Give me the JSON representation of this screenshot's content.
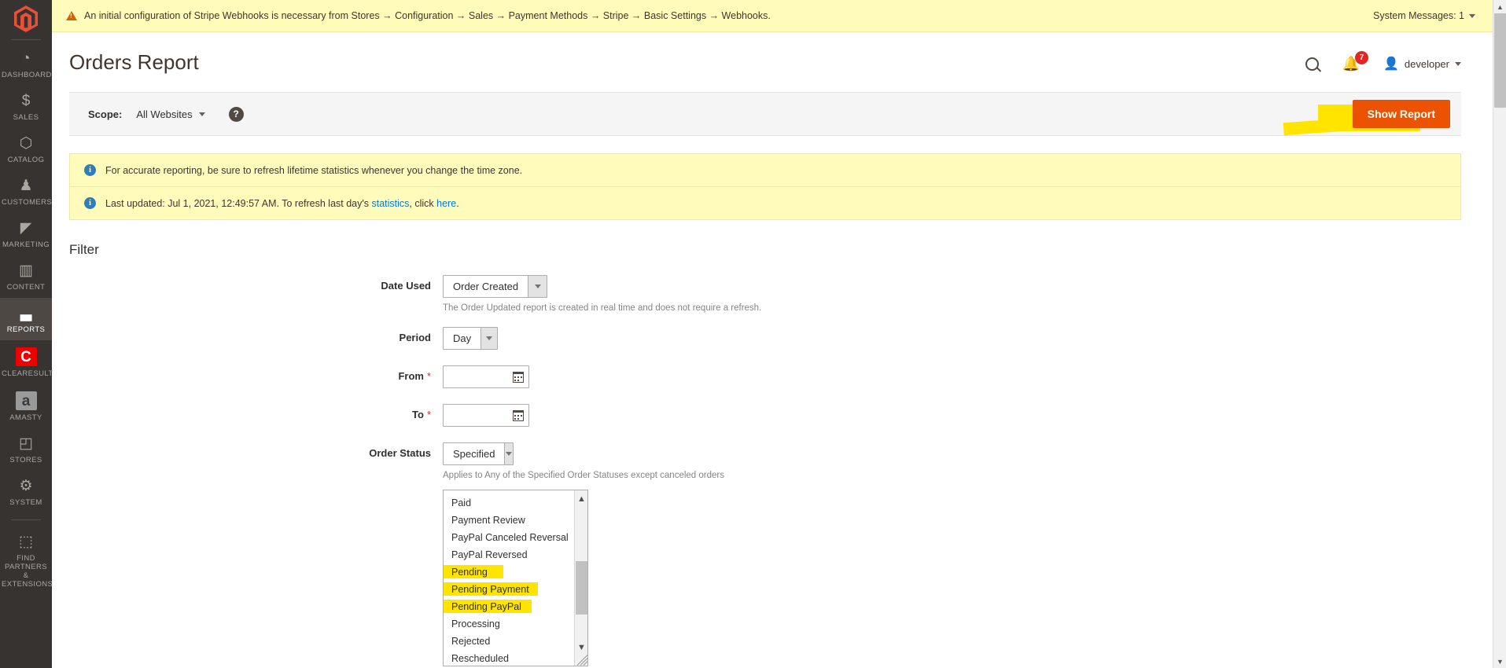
{
  "sysbar": {
    "warning": "An initial configuration of Stripe Webhooks is necessary from Stores → Configuration → Sales → Payment Methods → Stripe → Basic Settings → Webhooks.",
    "system_messages": "System Messages: 1"
  },
  "sidebar": {
    "items": [
      {
        "label": "Dashboard",
        "icon": "dashboard-gauge-icon"
      },
      {
        "label": "Sales",
        "icon": "dollar-icon"
      },
      {
        "label": "Catalog",
        "icon": "box-icon"
      },
      {
        "label": "Customers",
        "icon": "person-icon"
      },
      {
        "label": "Marketing",
        "icon": "megaphone-icon"
      },
      {
        "label": "Content",
        "icon": "layout-icon"
      },
      {
        "label": "Reports",
        "icon": "bar-chart-icon"
      },
      {
        "label": "Clearesult",
        "icon": "clearesult-logo-icon"
      },
      {
        "label": "Amasty",
        "icon": "amasty-logo-icon"
      },
      {
        "label": "Stores",
        "icon": "storefront-icon"
      },
      {
        "label": "System",
        "icon": "gear-icon"
      },
      {
        "label": "Find Partners\n& Extensions",
        "icon": "plugin-box-icon"
      }
    ]
  },
  "header": {
    "title": "Orders Report",
    "search_icon": "search-icon",
    "notifications_icon": "bell-icon",
    "notifications_count": "7",
    "user_name": "developer"
  },
  "scope": {
    "label": "Scope:",
    "value": "All Websites",
    "help_icon": "question-mark-icon",
    "show_report_label": "Show Report"
  },
  "messages": [
    {
      "icon": "info-icon",
      "text": "For accurate reporting, be sure to refresh lifetime statistics whenever you change the time zone."
    },
    {
      "icon": "info-icon",
      "prefix": "Last updated: Jul 1, 2021, 12:49:57 AM. To refresh last day's ",
      "link1": "statistics",
      "middle": ", click ",
      "link2": "here",
      "suffix": "."
    }
  ],
  "filter": {
    "title": "Filter",
    "date_used": {
      "label": "Date Used",
      "value": "Order Created",
      "hint": "The Order Updated report is created in real time and does not require a refresh."
    },
    "period": {
      "label": "Period",
      "value": "Day"
    },
    "from": {
      "label": "From",
      "value": "",
      "placeholder": "",
      "required": "*",
      "icon": "calendar-icon"
    },
    "to": {
      "label": "To",
      "value": "",
      "placeholder": "",
      "required": "*",
      "icon": "calendar-icon"
    },
    "order_status": {
      "label": "Order Status",
      "value": "Specified",
      "hint": "Applies to Any of the Specified Order Statuses except canceled orders"
    },
    "status_options": [
      {
        "label": "",
        "clipped": true,
        "highlighted": false
      },
      {
        "label": "Paid",
        "highlighted": false
      },
      {
        "label": "Payment Review",
        "highlighted": false
      },
      {
        "label": "PayPal Canceled Reversal",
        "highlighted": false
      },
      {
        "label": "PayPal Reversed",
        "highlighted": false
      },
      {
        "label": "Pending",
        "highlighted": true
      },
      {
        "label": "Pending Payment",
        "highlighted": true
      },
      {
        "label": "Pending PayPal",
        "highlighted": true
      },
      {
        "label": "Processing",
        "highlighted": false
      },
      {
        "label": "Rejected",
        "highlighted": false
      },
      {
        "label": "Rescheduled",
        "highlighted": false
      }
    ]
  },
  "colors": {
    "accent": "#eb5202",
    "highlight": "#ffe400",
    "banner_bg": "#fffbbb",
    "sidebar_bg": "#373330",
    "link": "#007bdb",
    "badge": "#e22626"
  }
}
